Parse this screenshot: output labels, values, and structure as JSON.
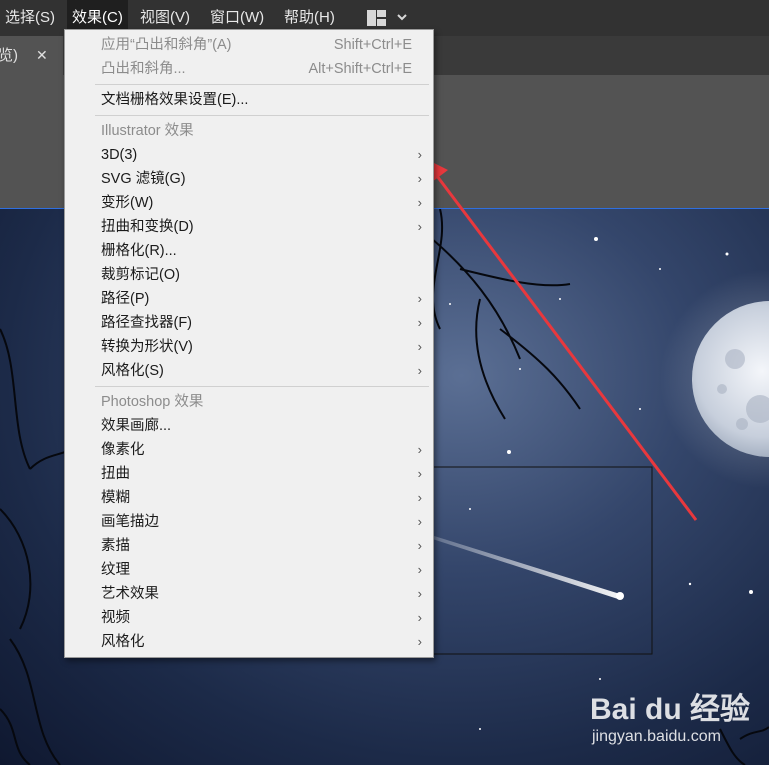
{
  "menubar": {
    "items": [
      "选择(S)",
      "效果(C)",
      "视图(V)",
      "窗口(W)",
      "帮助(H)"
    ],
    "active_index": 1
  },
  "tab": {
    "label": "览)",
    "close_glyph": "✕"
  },
  "effects_menu": {
    "apply_last": {
      "label": "应用“凸出和斜角”(A)",
      "shortcut": "Shift+Ctrl+E"
    },
    "last_effect": {
      "label": "凸出和斜角...",
      "shortcut": "Alt+Shift+Ctrl+E"
    },
    "raster_settings": "文档栅格效果设置(E)...",
    "illustrator_header": "Illustrator 效果",
    "illustrator_items": [
      "3D(3)",
      "SVG 滤镜(G)",
      "变形(W)",
      "扭曲和变换(D)",
      "栅格化(R)...",
      "裁剪标记(O)",
      "路径(P)",
      "路径查找器(F)",
      "转换为形状(V)",
      "风格化(S)"
    ],
    "photoshop_header": "Photoshop 效果",
    "photoshop_items": [
      "效果画廊...",
      "像素化",
      "扭曲",
      "模糊",
      "画笔描边",
      "素描",
      "纹理",
      "艺术效果",
      "视频",
      "风格化"
    ]
  },
  "submenu_arrow": "›",
  "annotation": {
    "color": "#e8383d"
  },
  "watermark": {
    "logo": "Bai du 经验",
    "url": "jingyan.baidu.com"
  }
}
